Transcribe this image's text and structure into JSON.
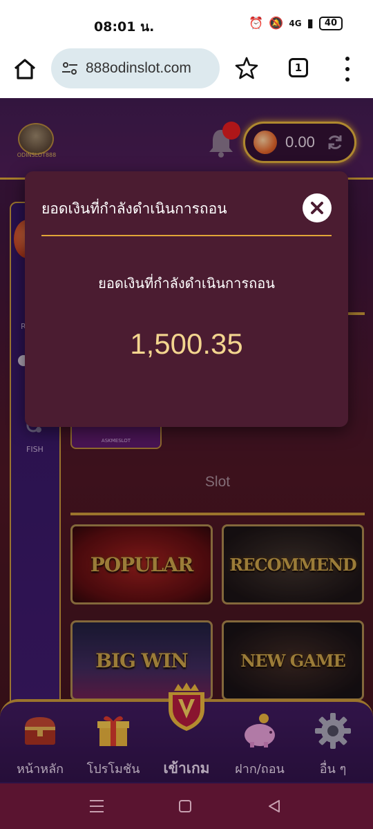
{
  "status_bar": {
    "time": "08:01 น.",
    "network": "4G",
    "battery": "40"
  },
  "browser": {
    "url": "888odinslot.com",
    "tab_count": "1"
  },
  "header": {
    "logo_text": "ODINSLOT888",
    "balance": "0.00"
  },
  "sidebar": {
    "label_r": "R",
    "fish_label": "FISH"
  },
  "content": {
    "askme_label": "ASKMESLOT",
    "slot_heading": "Slot",
    "categories": [
      "POPULAR",
      "RECOMMEND",
      "BIG WIN",
      "NEW GAME"
    ]
  },
  "modal": {
    "title": "ยอดเงินที่กำลังดำเนินการถอน",
    "label": "ยอดเงินที่กำลังดำเนินการถอน",
    "amount": "1,500.35"
  },
  "bottom_nav": {
    "items": [
      {
        "label": "หน้าหลัก",
        "icon": "chest-icon"
      },
      {
        "label": "โปรโมชัน",
        "icon": "gift-icon"
      },
      {
        "label": "เข้าเกม",
        "icon": "v-crown-shield-icon"
      },
      {
        "label": "ฝาก/ถอน",
        "icon": "piggy-bank-icon"
      },
      {
        "label": "อื่น ๆ",
        "icon": "gear-icon"
      }
    ]
  },
  "colors": {
    "accent_gold": "#e2a638",
    "modal_bg": "#4b1c31",
    "amount": "#f3d58f",
    "notification_red": "#e31c1c"
  }
}
